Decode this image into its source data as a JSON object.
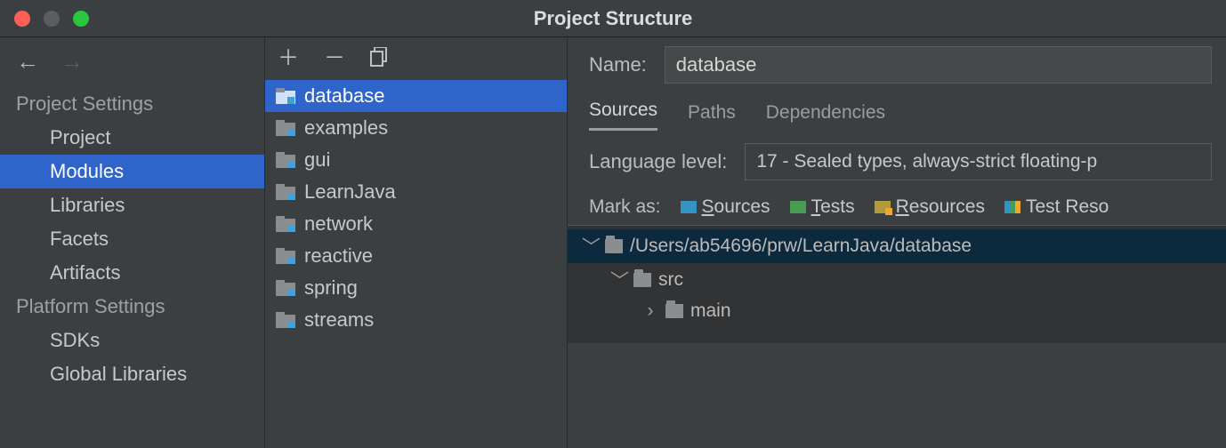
{
  "window": {
    "title": "Project Structure"
  },
  "sidebar": {
    "headings": {
      "project": "Project Settings",
      "platform": "Platform Settings"
    },
    "items": {
      "project": "Project",
      "modules": "Modules",
      "libraries": "Libraries",
      "facets": "Facets",
      "artifacts": "Artifacts",
      "sdks": "SDKs",
      "globallibs": "Global Libraries"
    },
    "selected": "modules"
  },
  "modules": {
    "items": [
      {
        "id": "database",
        "label": "database"
      },
      {
        "id": "examples",
        "label": "examples"
      },
      {
        "id": "gui",
        "label": "gui"
      },
      {
        "id": "learnjava",
        "label": "LearnJava"
      },
      {
        "id": "network",
        "label": "network"
      },
      {
        "id": "reactive",
        "label": "reactive"
      },
      {
        "id": "spring",
        "label": "spring"
      },
      {
        "id": "streams",
        "label": "streams"
      }
    ],
    "selected": "database"
  },
  "detail": {
    "name_label": "Name:",
    "name_value": "database",
    "tabs": {
      "sources": "Sources",
      "paths": "Paths",
      "dependencies": "Dependencies",
      "active": "sources"
    },
    "language_level_label": "Language level:",
    "language_level_value": "17 - Sealed types, always-strict floating-p",
    "mark_as": {
      "label": "Mark as:",
      "sources": {
        "pre": "S",
        "rest": "ources"
      },
      "tests": {
        "pre": "T",
        "rest": "ests"
      },
      "resources": {
        "pre": "R",
        "rest": "esources"
      },
      "test_resources": {
        "pre": "Test Reso",
        "rest": ""
      }
    },
    "tree": {
      "root": "/Users/ab54696/prw/LearnJava/database",
      "src": "src",
      "main": "main"
    }
  }
}
